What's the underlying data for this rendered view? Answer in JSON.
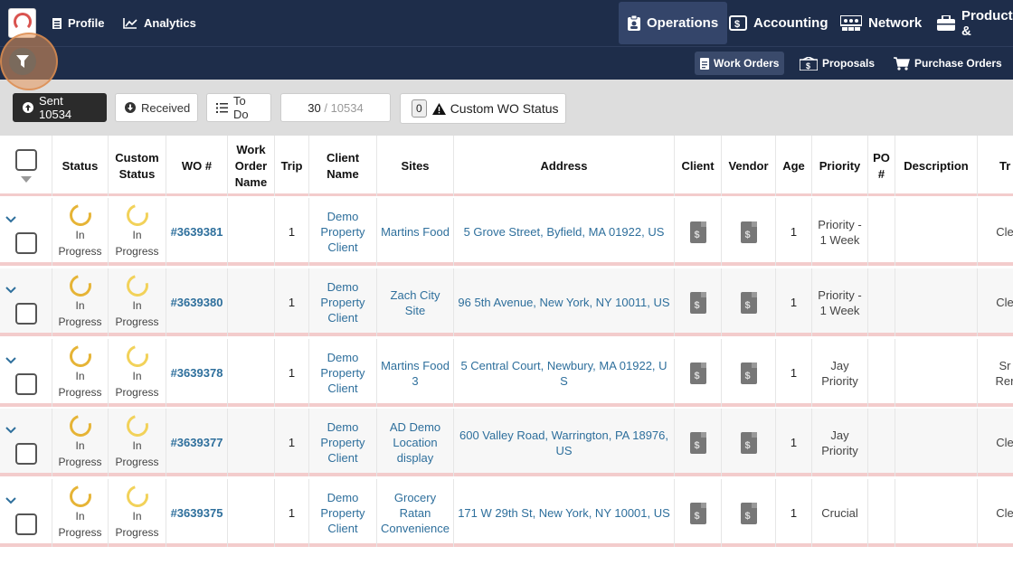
{
  "topnav": {
    "profile": "Profile",
    "analytics": "Analytics",
    "operations": "Operations",
    "accounting": "Accounting",
    "network": "Network",
    "product": "Product &"
  },
  "subnav": {
    "work_orders": "Work Orders",
    "proposals": "Proposals",
    "purchase_orders": "Purchase Orders"
  },
  "toolbar": {
    "sent": "Sent 10534",
    "received": "Received",
    "todo": "To Do",
    "count_current": "30",
    "count_sep": " / ",
    "count_total": "10534",
    "custom_count": "0",
    "custom_status": "Custom WO Status"
  },
  "columns": {
    "status": "Status",
    "custom_status": "Custom Status",
    "wo": "WO #",
    "work_order_name": "Work Order Name",
    "trip": "Trip",
    "client_name": "Client Name",
    "sites": "Sites",
    "address": "Address",
    "client": "Client",
    "vendor": "Vendor",
    "age": "Age",
    "priority": "Priority",
    "po": "PO #",
    "description": "Description",
    "tr": "Tr"
  },
  "rows": [
    {
      "status": "In Progress",
      "custom_status": "In Progress",
      "wo": "#3639381",
      "trip": "1",
      "client_name": "Demo Property Client",
      "site": "Martins Food",
      "address": "5 Grove Street, Byfield, MA 01922, US",
      "age": "1",
      "priority": "Priority - 1 Week",
      "tr": "Cle"
    },
    {
      "status": "In Progress",
      "custom_status": "In Progress",
      "wo": "#3639380",
      "trip": "1",
      "client_name": "Demo Property Client",
      "site": "Zach City Site",
      "address": "96 5th Avenue, New York, NY 10011, US",
      "age": "1",
      "priority": "Priority - 1 Week",
      "tr": "Cle"
    },
    {
      "status": "In Progress",
      "custom_status": "In Progress",
      "wo": "#3639378",
      "trip": "1",
      "client_name": "Demo Property Client",
      "site": "Martins Food 3",
      "address": "5 Central Court, Newbury, MA 01922, US",
      "age": "1",
      "priority": "Jay Priority",
      "tr": "Sr Rer"
    },
    {
      "status": "In Progress",
      "custom_status": "In Progress",
      "wo": "#3639377",
      "trip": "1",
      "client_name": "Demo Property Client",
      "site": "AD Demo Location display",
      "address": "600 Valley Road, Warrington, PA 18976, US",
      "age": "1",
      "priority": "Jay Priority",
      "tr": "Cle"
    },
    {
      "status": "In Progress",
      "custom_status": "In Progress",
      "wo": "#3639375",
      "trip": "1",
      "client_name": "Demo Property Client",
      "site": "Grocery Ratan Convenience",
      "address": "171 W 29th St, New York, NY 10001, US",
      "age": "1",
      "priority": "Crucial",
      "tr": "Cle"
    }
  ]
}
